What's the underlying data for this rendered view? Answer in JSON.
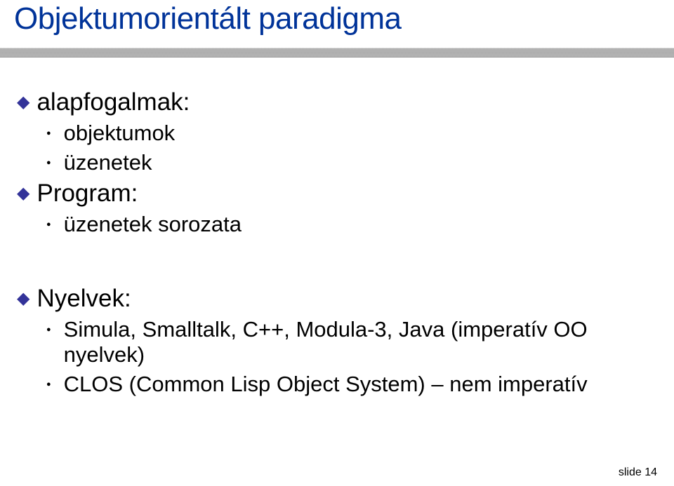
{
  "title": "Objektumorientált paradigma",
  "sections": {
    "alapfogalmak": {
      "heading": "alapfogalmak:",
      "items": [
        "objektumok",
        "üzenetek"
      ]
    },
    "program": {
      "heading": "Program:",
      "items": [
        "üzenetek sorozata"
      ]
    },
    "nyelvek": {
      "heading": "Nyelvek:",
      "items": [
        "Simula, Smalltalk, C++, Modula-3, Java (imperatív OO nyelvek)",
        "CLOS (Common Lisp Object System) – nem imperatív"
      ]
    }
  },
  "slide_label": "slide 14"
}
